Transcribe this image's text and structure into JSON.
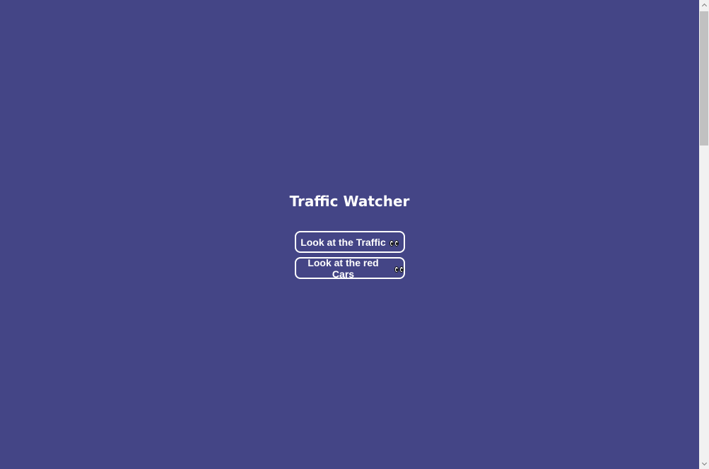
{
  "page": {
    "title": "Traffic Watcher"
  },
  "buttons": [
    {
      "label": "Look at the Traffic",
      "icon": "eyes-icon"
    },
    {
      "label": "Look at the red Cars",
      "icon": "eyes-icon"
    }
  ],
  "colors": {
    "background": "#444586",
    "text": "#ffffff",
    "button_border": "#ffffff"
  }
}
